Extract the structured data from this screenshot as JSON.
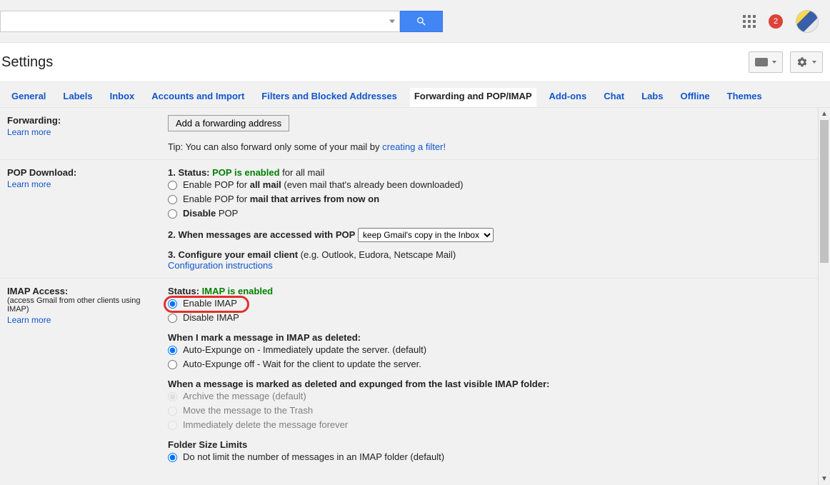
{
  "topbar": {
    "notif_count": "2"
  },
  "page_title": "Settings",
  "tabs": [
    {
      "label": "General"
    },
    {
      "label": "Labels"
    },
    {
      "label": "Inbox"
    },
    {
      "label": "Accounts and Import"
    },
    {
      "label": "Filters and Blocked Addresses"
    },
    {
      "label": "Forwarding and POP/IMAP"
    },
    {
      "label": "Add-ons"
    },
    {
      "label": "Chat"
    },
    {
      "label": "Labs"
    },
    {
      "label": "Offline"
    },
    {
      "label": "Themes"
    }
  ],
  "active_tab": "Forwarding and POP/IMAP",
  "forwarding": {
    "heading": "Forwarding:",
    "learn_more": "Learn more",
    "add_btn": "Add a forwarding address",
    "tip_prefix": "Tip: You can also forward only some of your mail by ",
    "tip_link": "creating a filter!"
  },
  "pop": {
    "heading": "POP Download:",
    "learn_more": "Learn more",
    "status_prefix": "1. Status: ",
    "status_value": "POP is enabled",
    "status_suffix": " for all mail",
    "opt1_prefix": "Enable POP for ",
    "opt1_bold": "all mail",
    "opt1_suffix": " (even mail that's already been downloaded)",
    "opt2_prefix": "Enable POP for ",
    "opt2_bold": "mail that arrives from now on",
    "opt3_bold": "Disable",
    "opt3_suffix": " POP",
    "step2_label": "2. When messages are accessed with POP",
    "step2_select": "keep Gmail's copy in the Inbox",
    "step3_prefix": "3. Configure your email client ",
    "step3_suffix": "(e.g. Outlook, Eudora, Netscape Mail)",
    "config_link": "Configuration instructions"
  },
  "imap": {
    "heading": "IMAP Access:",
    "subnote": "(access Gmail from other clients using IMAP)",
    "learn_more": "Learn more",
    "status_prefix": "Status: ",
    "status_value": "IMAP is enabled",
    "enable_label": "Enable IMAP",
    "disable_label": "Disable IMAP",
    "deleted_heading": "When I mark a message in IMAP as deleted:",
    "expunge_on": "Auto-Expunge on - Immediately update the server. (default)",
    "expunge_off": "Auto-Expunge off - Wait for the client to update the server.",
    "expunged_heading": "When a message is marked as deleted and expunged from the last visible IMAP folder:",
    "archive": "Archive the message (default)",
    "trash": "Move the message to the Trash",
    "delete_forever": "Immediately delete the message forever",
    "folder_heading": "Folder Size Limits",
    "folder_opt1": "Do not limit the number of messages in an IMAP folder (default)"
  }
}
